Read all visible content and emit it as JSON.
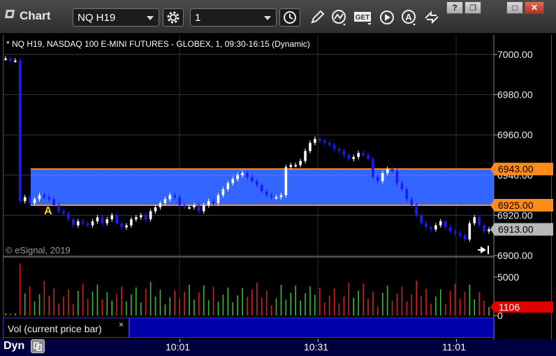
{
  "window": {
    "title": "Chart",
    "symbol_value": "NQ H19",
    "interval_value": "1",
    "buttons": {
      "help": "?",
      "restore": "❐",
      "maximize": "□",
      "close": "✕"
    }
  },
  "toolbar_icons": [
    "settings-gear-icon",
    "clock-icon",
    "pencil-icon",
    "studies-icon",
    "get-icon",
    "play-icon",
    "a-icon",
    "arrows-icon"
  ],
  "toolbar_get_label": "GET",
  "legend": "* NQ H19, NASDAQ 100 E-MINI FUTURES - GLOBEX, 1, 09:30-16:15 (Dynamic)",
  "copyright": "© eSignal, 2019",
  "chart_marker": "A",
  "study": {
    "label": "Vol (current price bar)",
    "close": "×"
  },
  "status": {
    "mode": "Dyn"
  },
  "colors": {
    "up_candle": "#ffffff",
    "down_candle": "#1a1aff",
    "band": "#3366ff",
    "band_lines": "#ff8c1a",
    "last_price_tag": "#b8b8b8",
    "volume_tag": "#e00000",
    "volume_up": "#2fbf2f",
    "volume_down": "#d22020"
  },
  "chart_data": [
    {
      "type": "candlestick",
      "ylim": [
        6900,
        7008
      ],
      "y_ticks": [
        "7000.00",
        "6980.00",
        "6960.00",
        "6940.00",
        "6920.00",
        "6900.00"
      ],
      "x_ticks": [
        "10:01",
        "10:31",
        "11:01"
      ],
      "band": {
        "upper": 6943.0,
        "lower": 6925.0
      },
      "price_tags": [
        {
          "label": "6943.00",
          "value": 6943.0,
          "kind": "band"
        },
        {
          "label": "6925.00",
          "value": 6925.0,
          "kind": "band"
        },
        {
          "label": "6913.00",
          "value": 6913.0,
          "kind": "last"
        }
      ],
      "close_series": [
        6998,
        6997,
        6997,
        6927,
        6929,
        6926,
        6928,
        6930,
        6929,
        6928,
        6925,
        6922,
        6921,
        6918,
        6915,
        6917,
        6916,
        6915,
        6917,
        6919,
        6916,
        6918,
        6920,
        6916,
        6914,
        6915,
        6918,
        6919,
        6920,
        6918,
        6922,
        6924,
        6926,
        6928,
        6930,
        6929,
        6925,
        6924,
        6924,
        6925,
        6922,
        6925,
        6927,
        6926,
        6930,
        6933,
        6936,
        6938,
        6940,
        6941,
        6939,
        6937,
        6935,
        6932,
        6930,
        6929,
        6929,
        6930,
        6944,
        6945,
        6945,
        6947,
        6952,
        6956,
        6958,
        6957,
        6956,
        6955,
        6953,
        6952,
        6950,
        6948,
        6949,
        6951,
        6950,
        6948,
        6939,
        6937,
        6941,
        6943,
        6942,
        6936,
        6933,
        6928,
        6925,
        6920,
        6916,
        6914,
        6913,
        6915,
        6917,
        6914,
        6912,
        6911,
        6910,
        6908,
        6916,
        6919,
        6915,
        6912,
        6913
      ]
    },
    {
      "type": "bar",
      "title": "Vol (current price bar)",
      "y_ticks": [
        "5000",
        "0"
      ],
      "last_value_label": "1106",
      "last_value": 1106,
      "ylim": [
        0,
        7000
      ]
    }
  ]
}
